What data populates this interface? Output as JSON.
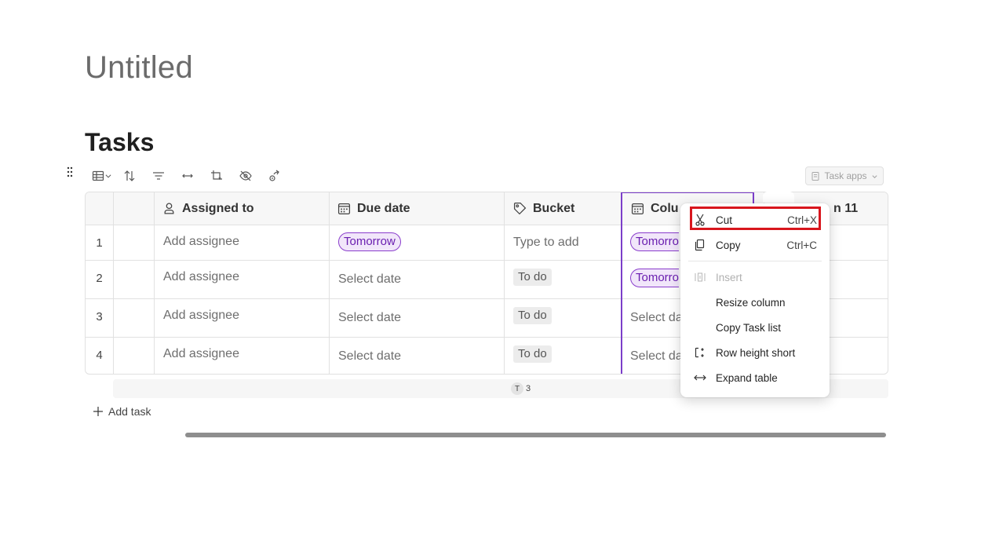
{
  "page": {
    "title": "Untitled"
  },
  "section": {
    "title": "Tasks"
  },
  "toolbar": {
    "task_apps_label": "Task apps",
    "icons": [
      "grid-view-icon",
      "chevron-down-icon",
      "sort-icon",
      "filter-icon",
      "resize-width-icon",
      "crop-icon",
      "hide-icon",
      "share-icon"
    ]
  },
  "table": {
    "columns": [
      {
        "label": "Assigned to",
        "icon": "person-icon"
      },
      {
        "label": "Due date",
        "icon": "calendar-icon"
      },
      {
        "label": "Bucket",
        "icon": "tag-icon"
      },
      {
        "label": "Colu",
        "icon": "calendar-icon"
      },
      {
        "label": "n 11",
        "icon": ""
      }
    ],
    "rows": [
      {
        "num": "1",
        "assignee": "Add assignee",
        "due": "Tomorrow",
        "bucket": "Type to add",
        "col": "Tomorro"
      },
      {
        "num": "2",
        "assignee": "Add assignee",
        "due": "Select date",
        "bucket": "To do",
        "col": "Tomorro"
      },
      {
        "num": "3",
        "assignee": "Add assignee",
        "due": "Select date",
        "bucket": "To do",
        "col": "Select da"
      },
      {
        "num": "4",
        "assignee": "Add assignee",
        "due": "Select date",
        "bucket": "To do",
        "col": "Select da"
      }
    ],
    "summary": {
      "chip_letter": "T",
      "chip_count": "3"
    }
  },
  "add_task_label": "Add task",
  "context_menu": {
    "items": [
      {
        "label": "Cut",
        "shortcut": "Ctrl+X",
        "icon": "scissors-icon",
        "enabled": true
      },
      {
        "label": "Copy",
        "shortcut": "Ctrl+C",
        "icon": "copy-icon",
        "enabled": true
      },
      {
        "label": "Insert",
        "shortcut": "",
        "icon": "insert-column-icon",
        "enabled": false
      },
      {
        "label": "Resize column",
        "shortcut": "",
        "icon": "",
        "enabled": true
      },
      {
        "label": "Copy Task list",
        "shortcut": "",
        "icon": "",
        "enabled": true
      },
      {
        "label": "Row height short",
        "shortcut": "",
        "icon": "row-height-icon",
        "enabled": true
      },
      {
        "label": "Expand table",
        "shortcut": "",
        "icon": "expand-icon",
        "enabled": true
      }
    ],
    "highlighted_item": "Cut",
    "highlight_color": "#d8161d"
  },
  "colors": {
    "accent": "#7b3ec9",
    "pill_bg": "#f1e6fa",
    "pill_text": "#6a1fb0"
  }
}
